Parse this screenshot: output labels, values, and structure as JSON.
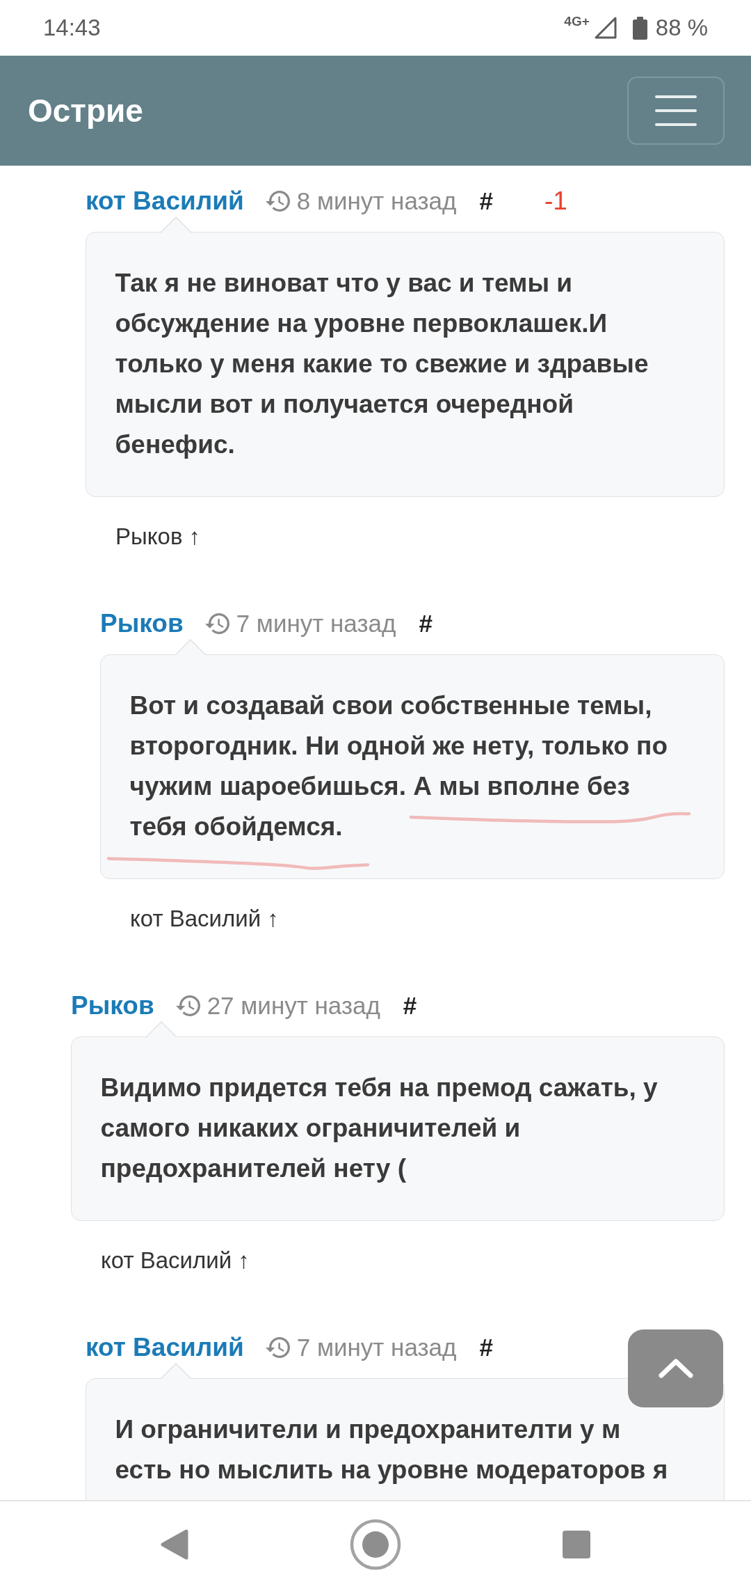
{
  "status_bar": {
    "time": "14:43",
    "network": "4G+",
    "battery": "88 %"
  },
  "header": {
    "title": "Острие"
  },
  "comments": [
    {
      "children": [
        {
          "author": "кот Василий",
          "time": "8 минут назад",
          "anchor": "#",
          "score": "-1",
          "body": "Так я не виноват что у вас и темы и\nобсуждение на уровне первоклашек.И\nтолько у меня какие то свежие и здравые\nмысли вот и получается очередной\nбенефис.",
          "underlined": false,
          "parent_link": "Рыков ↑",
          "children": [
            {
              "author": "Рыков",
              "time": "7 минут назад",
              "anchor": "#",
              "body": "Вот и создавай свои собственные темы,\nвторогодник. Ни одной же нету, только по\nчужим шароебишься. А мы вполне без\nтебя обойдемся.",
              "underlined": true,
              "parent_link": "кот Василий ↑"
            }
          ]
        }
      ]
    },
    {
      "author": "Рыков",
      "time": "27 минут назад",
      "anchor": "#",
      "body": "Видимо придется тебя на премод сажать, у\nсамого никаких ограничителей и\nпредохранителей нету (",
      "underlined": false,
      "parent_link": "кот Василий ↑",
      "children": [
        {
          "author": "кот Василий",
          "time": "7 минут назад",
          "anchor": "#",
          "body": "И ограничители и предохранителти у м\nесть но мыслить на уровне модераторов я",
          "underlined": false
        }
      ]
    }
  ]
}
